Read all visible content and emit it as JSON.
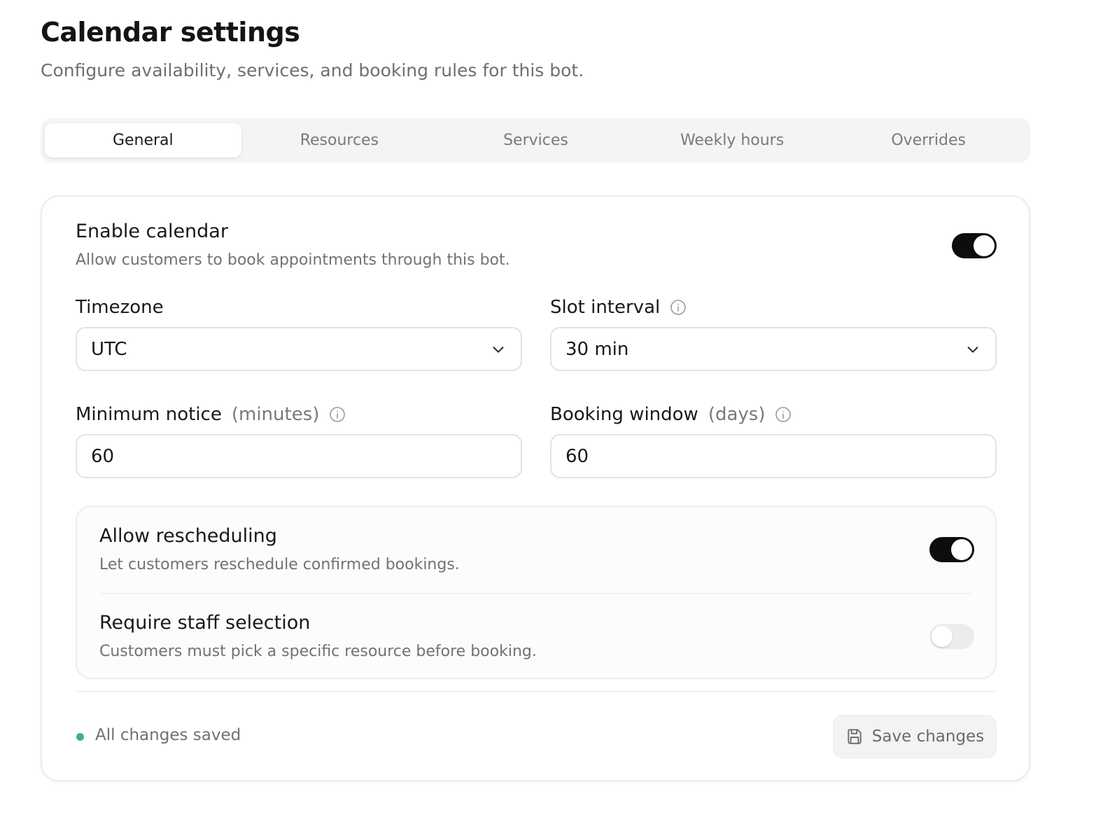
{
  "page": {
    "title": "Calendar settings",
    "subtitle": "Configure availability, services, and booking rules for this bot."
  },
  "tabs": [
    {
      "label": "General",
      "active": true
    },
    {
      "label": "Resources",
      "active": false
    },
    {
      "label": "Services",
      "active": false
    },
    {
      "label": "Weekly hours",
      "active": false
    },
    {
      "label": "Overrides",
      "active": false
    }
  ],
  "enable_calendar": {
    "title": "Enable calendar",
    "description": "Allow customers to book appointments through this bot.",
    "enabled": true
  },
  "timezone": {
    "label": "Timezone",
    "value": "UTC"
  },
  "slot_interval": {
    "label": "Slot interval",
    "value": "30 min",
    "icon": "info-icon"
  },
  "minimum_notice": {
    "label": "Minimum notice",
    "unit": "(minutes)",
    "value": "60",
    "icon": "info-icon"
  },
  "booking_window": {
    "label": "Booking window",
    "unit": "(days)",
    "value": "60",
    "icon": "info-icon"
  },
  "allow_rescheduling": {
    "title": "Allow rescheduling",
    "description": "Let customers reschedule confirmed bookings.",
    "enabled": true
  },
  "require_staff": {
    "title": "Require staff selection",
    "description": "Customers must pick a specific resource before booking.",
    "enabled": false
  },
  "footer": {
    "status_text": "All changes saved",
    "status_color": "#3db37a",
    "save_label": "Save changes",
    "save_icon": "floppy-disk-icon"
  },
  "colors": {
    "switch_on": "#0d0d0d",
    "switch_off": "#ececec",
    "tab_bar": "#f4f4f4"
  }
}
